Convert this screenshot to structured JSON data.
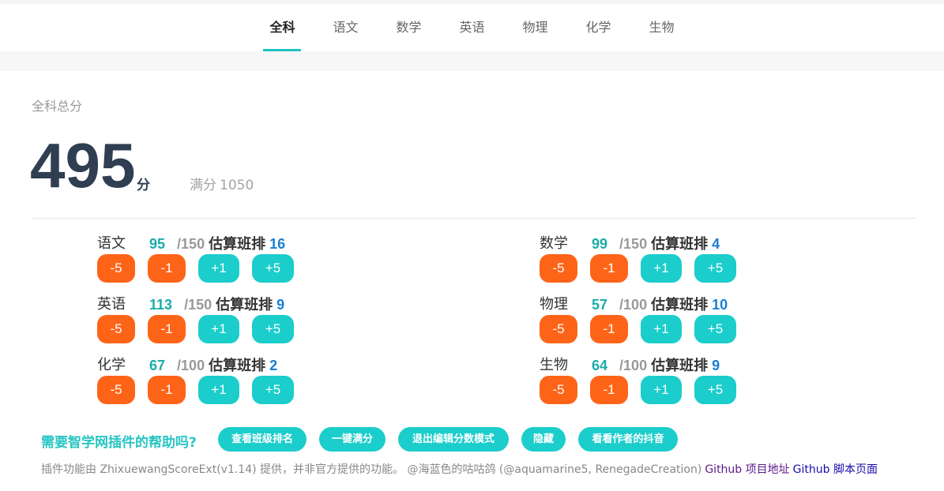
{
  "tabs": [
    {
      "label": "全科",
      "active": true
    },
    {
      "label": "语文",
      "active": false
    },
    {
      "label": "数学",
      "active": false
    },
    {
      "label": "英语",
      "active": false
    },
    {
      "label": "物理",
      "active": false
    },
    {
      "label": "化学",
      "active": false
    },
    {
      "label": "生物",
      "active": false
    }
  ],
  "summary": {
    "label": "全科总分",
    "score": "495",
    "unit": "分",
    "full_label": "满分",
    "full_value": "1050"
  },
  "rank_label": "估算班排",
  "buttons": {
    "m5": "-5",
    "m1": "-1",
    "p1": "+1",
    "p5": "+5"
  },
  "subjects": [
    {
      "name": "语文",
      "score": "95",
      "max": "/150",
      "rank": "16"
    },
    {
      "name": "数学",
      "score": "99",
      "max": "/150",
      "rank": "4"
    },
    {
      "name": "英语",
      "score": "113",
      "max": "/150",
      "rank": "9"
    },
    {
      "name": "物理",
      "score": "57",
      "max": "/100",
      "rank": "10"
    },
    {
      "name": "化学",
      "score": "67",
      "max": "/100",
      "rank": "2"
    },
    {
      "name": "生物",
      "score": "64",
      "max": "/100",
      "rank": "9"
    }
  ],
  "help": {
    "question": "需要智学网插件的帮助吗?",
    "actions": [
      "查看班级排名",
      "一键满分",
      "退出编辑分数模式",
      "隐藏",
      "看看作者的抖音"
    ]
  },
  "footer": {
    "text": "插件功能由 ZhixuewangScoreExt(v1.14) 提供，并非官方提供的功能。 @海蓝色的咕咕鸽 (@aquamarine5, RenegadeCreation)",
    "link1": "Github 项目地址",
    "link2": "Github 脚本页面"
  },
  "colors": {
    "accent": "#1bcdcb",
    "minus": "#fe6418",
    "score_text": "#1aaca9",
    "rank_text": "#1a7fd4",
    "total_text": "#2f3e51"
  }
}
